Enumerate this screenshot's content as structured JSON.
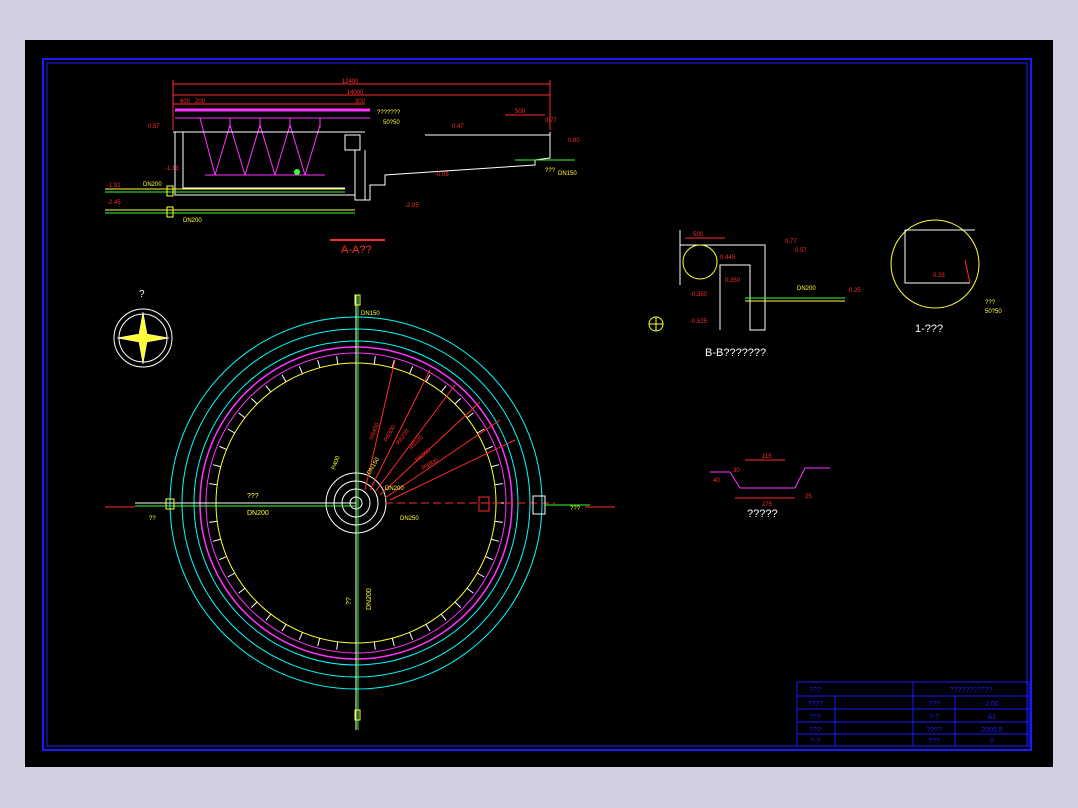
{
  "colors": {
    "bg": "#000000",
    "border": "#1a1aff",
    "red": "#ff2a2a",
    "yellow": "#ffff33",
    "cyan": "#00ffff",
    "magenta": "#ff33ff",
    "green": "#33ff33",
    "white": "#ffffff"
  },
  "section_aa": {
    "title": "A-A??",
    "dims": [
      "12400",
      "14000",
      "600",
      "200",
      "300",
      "500",
      "500"
    ],
    "levels": [
      "0.57",
      "-1.13",
      "-1.91",
      "-2.45",
      "0.47",
      "0.77",
      "0.80",
      "-2.05",
      "-0.05"
    ],
    "labels": [
      "DN200",
      "DN200",
      "???????",
      "50?50",
      "???",
      "DN150"
    ]
  },
  "section_bb": {
    "title": "B-B???????",
    "dims": [
      "500"
    ],
    "levels": [
      "0.77",
      "0.57",
      "0.445",
      "0.350",
      "-0.350",
      "-0.525",
      "-0.25"
    ],
    "labels": [
      "DN200"
    ]
  },
  "detail_1": {
    "title": "1-???",
    "labels": [
      "0.28",
      "???",
      "50?50"
    ]
  },
  "weir": {
    "title": "?????",
    "labels": [
      "115",
      "30",
      "40",
      "25",
      "275"
    ]
  },
  "compass": {
    "label": "?"
  },
  "plan": {
    "labels": [
      "???",
      "DN200",
      "??",
      "DN200",
      "??",
      "???",
      "DN150",
      "DN200",
      "P400",
      "DN150",
      "DN250"
    ],
    "radius_labels": [
      "R6450",
      "R6300",
      "R6200",
      "R6100",
      "R5950",
      "R5800"
    ]
  },
  "title_block": {
    "rows": [
      [
        "???",
        "",
        "???????????",
        ""
      ],
      [
        "????",
        "",
        "???",
        "1:00"
      ],
      [
        "???",
        "",
        "?-?",
        "A1"
      ],
      [
        "???",
        "",
        "????",
        "2005.5"
      ],
      [
        "?-?",
        "",
        "???",
        "0"
      ]
    ]
  }
}
